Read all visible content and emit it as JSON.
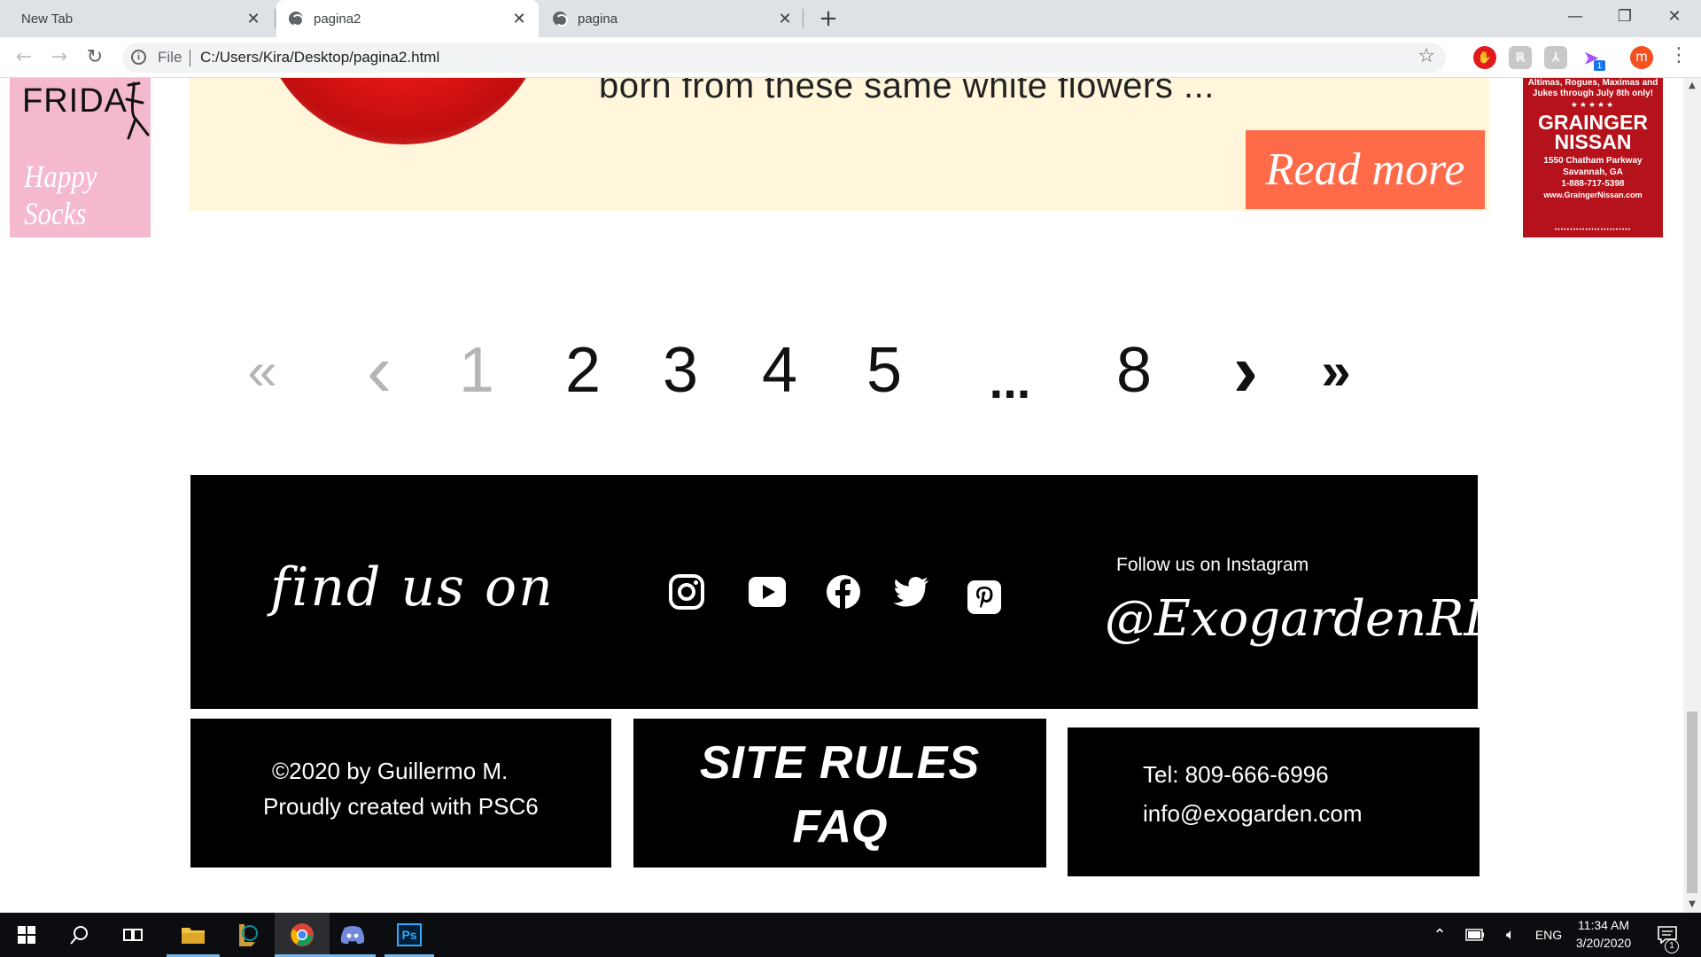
{
  "browser": {
    "tabs": [
      {
        "title": "New Tab",
        "active": false
      },
      {
        "title": "pagina2",
        "active": true
      },
      {
        "title": "pagina",
        "active": false
      }
    ],
    "new_tab_glyph": "+",
    "window_controls": {
      "minimize": "—",
      "restore": "❐",
      "close": "✕"
    },
    "address": {
      "scheme_label": "File",
      "url": "C:/Users/Kira/Desktop/pagina2.html"
    },
    "profile_initial": "m",
    "extension_badge": "1"
  },
  "page": {
    "ad_left": {
      "brand_top": "FRIDA",
      "brand_bottom": "Happy Socks"
    },
    "feature": {
      "blurb": "born from these same white flowers ...",
      "read_more": "Read more"
    },
    "ad_right": {
      "top_text": "Altimas, Rogues, Maximas and Jukes through July 8th only!",
      "stars": "★★★★★",
      "name_line1": "GRAINGER",
      "name_line2": "NISSAN",
      "address_line1": "1550 Chatham Parkway",
      "address_line2": "Savannah, GA",
      "phone": "1-888-717-5398",
      "website": "www.GraingerNissan.com"
    },
    "pagination": {
      "first": "«",
      "prev": "‹",
      "pages": [
        "1",
        "2",
        "3",
        "4",
        "5",
        "...",
        "8"
      ],
      "next": "›",
      "last": "»",
      "current_page": "1"
    },
    "footer": {
      "find_us": "find us on",
      "social_icons": [
        "instagram-icon",
        "youtube-icon",
        "facebook-icon",
        "twitter-icon",
        "pinterest-icon"
      ],
      "follow_label": "Follow us on Instagram",
      "handle": "@ExogardenRD",
      "copyright_line1": "©2020 by Guillermo M.",
      "copyright_line2": "Proudly created with PSC6",
      "site_rules": "SITE RULES",
      "faq": "FAQ",
      "tel": "Tel: 809-666-6996",
      "email": "info@exogarden.com"
    }
  },
  "taskbar": {
    "apps": [
      "start-icon",
      "search-icon",
      "task-view-icon",
      "file-explorer-icon",
      "league-icon",
      "chrome-icon",
      "discord-icon",
      "photoshop-icon"
    ],
    "photoshop_label": "Ps",
    "language": "ENG",
    "time": "11:34 AM",
    "date": "3/20/2020",
    "notification_count": "1"
  },
  "colors": {
    "card_bg": "#fff6db",
    "read_more_bg": "#ff6a49",
    "ad_left_bg": "#f4b8cf",
    "ad_right_bg": "#b5121b",
    "footer_bg": "#000000",
    "profile_bg": "#f4511e"
  }
}
